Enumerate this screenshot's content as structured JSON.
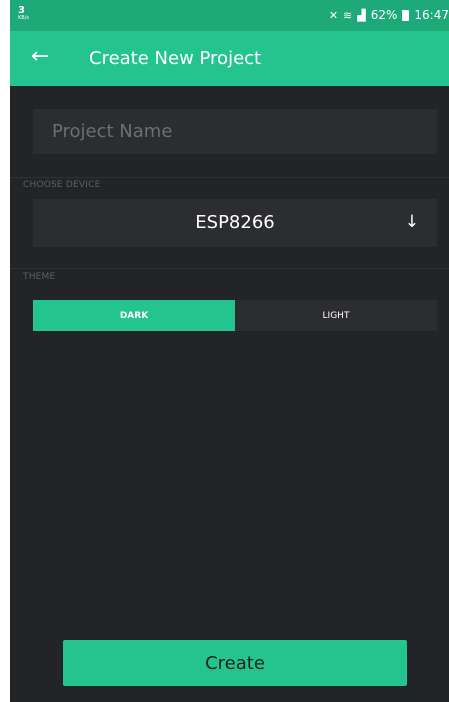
{
  "status_bar": {
    "speed_value": "3",
    "speed_unit": "KB/s",
    "mute_icon": "vibrate-mute-icon",
    "wifi_icon": "wifi-icon",
    "signal_icon": "signal-icon",
    "battery_percent": "62%",
    "battery_icon": "battery-icon",
    "time": "16:47"
  },
  "app_bar": {
    "back_icon": "arrow-back-icon",
    "title": "Create New Project"
  },
  "form": {
    "project_name": {
      "value": "",
      "placeholder": "Project Name"
    },
    "choose_device_label": "CHOOSE DEVICE",
    "device": {
      "selected": "ESP8266",
      "icon": "arrow-down-icon"
    },
    "theme_label": "THEME",
    "theme_options": [
      "DARK",
      "LIGHT"
    ],
    "theme_selected": "DARK"
  },
  "create_button_label": "Create",
  "colors": {
    "accent": "#23c48e",
    "status_bar": "#1ea979",
    "background": "#232427",
    "field_background": "#2c2d31",
    "placeholder": "#6b6e74",
    "section_label": "#5c5f64"
  }
}
